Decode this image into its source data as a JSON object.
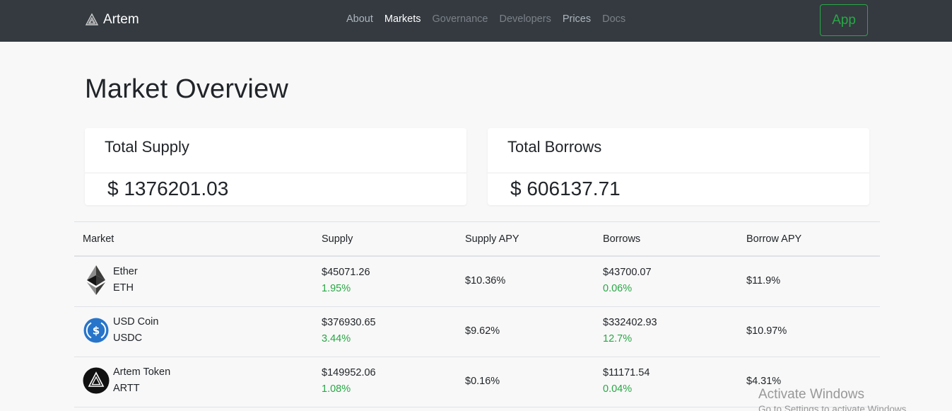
{
  "nav": {
    "brand": "Artem",
    "links": [
      {
        "label": "About"
      },
      {
        "label": "Markets"
      },
      {
        "label": "Governance"
      },
      {
        "label": "Developers"
      },
      {
        "label": "Prices"
      },
      {
        "label": "Docs"
      }
    ],
    "app_button": "App"
  },
  "page": {
    "title": "Market Overview"
  },
  "cards": {
    "supply": {
      "title": "Total Supply",
      "value": "$ 1376201.03"
    },
    "borrows": {
      "title": "Total Borrows",
      "value": "$ 606137.71"
    }
  },
  "table": {
    "headers": [
      "Market",
      "Supply",
      "Supply APY",
      "Borrows",
      "Borrow APY"
    ],
    "rows": [
      {
        "name": "Ether",
        "symbol": "ETH",
        "icon": "ether-icon",
        "supply": "$45071.26",
        "supply_change": "1.95%",
        "supply_apy": "$10.36%",
        "borrows": "$43700.07",
        "borrows_change": "0.06%",
        "borrow_apy": "$11.9%"
      },
      {
        "name": "USD Coin",
        "symbol": "USDC",
        "icon": "usdc-icon",
        "supply": "$376930.65",
        "supply_change": "3.44%",
        "supply_apy": "$9.62%",
        "borrows": "$332402.93",
        "borrows_change": "12.7%",
        "borrow_apy": "$10.97%"
      },
      {
        "name": "Artem Token",
        "symbol": "ARTT",
        "icon": "artem-token-icon",
        "supply": "$149952.06",
        "supply_change": "1.08%",
        "supply_apy": "$0.16%",
        "borrows": "$11171.54",
        "borrows_change": "0.04%",
        "borrow_apy": "$4.31%"
      }
    ]
  },
  "watermark": {
    "line1": "Activate Windows",
    "line2": "Go to Settings to activate Windows."
  },
  "colors": {
    "navbar": "#343a40",
    "accent_green": "#28a745",
    "background": "#f8f8f8"
  }
}
